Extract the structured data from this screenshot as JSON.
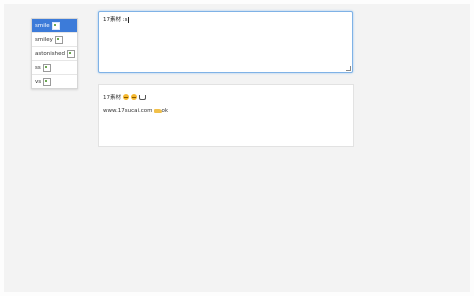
{
  "emoji_menu": {
    "items": [
      {
        "label": "smile",
        "selected": true,
        "icon": "broken-image-icon"
      },
      {
        "label": "smiley",
        "selected": false,
        "icon": "broken-image-icon"
      },
      {
        "label": "astonished",
        "selected": false,
        "icon": "broken-image-icon"
      },
      {
        "label": "ss",
        "selected": false,
        "icon": "broken-image-icon"
      },
      {
        "label": "vs",
        "selected": false,
        "icon": "broken-image-icon"
      }
    ]
  },
  "editor": {
    "value": "17素材 :s"
  },
  "preview": {
    "line1_text": "17素材",
    "line1_icons": [
      "smiley-icon",
      "smiley-icon",
      "coffee-cup-icon"
    ],
    "line2_text": "www.17sucai.com",
    "line2_icons": [
      "clapping-hands-icon"
    ],
    "line2_tail": "ok"
  },
  "colors": {
    "menu_selected_bg": "#3c7bd9",
    "editor_focus_border": "#7fb2e6"
  }
}
